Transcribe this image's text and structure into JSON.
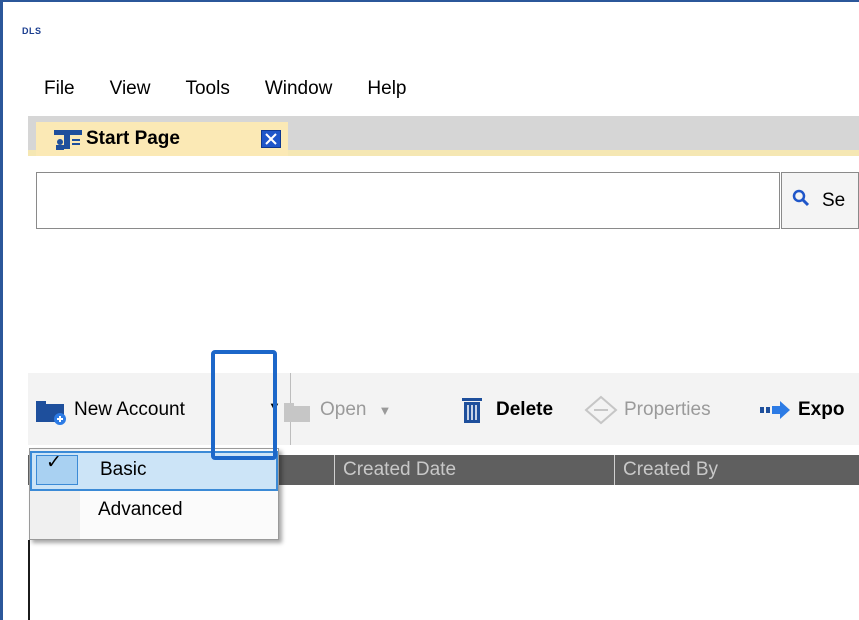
{
  "app": {
    "logo_text": "DLS"
  },
  "menu": {
    "items": [
      "File",
      "View",
      "Tools",
      "Window",
      "Help"
    ]
  },
  "tabs": [
    {
      "label": "Start Page"
    }
  ],
  "search": {
    "value": "",
    "button_label": "Se"
  },
  "toolbar": {
    "new_account": "New Account",
    "open": "Open",
    "delete": "Delete",
    "properties": "Properties",
    "export": "Expo"
  },
  "dropdown": {
    "items": [
      {
        "label": "Basic",
        "checked": true
      },
      {
        "label": "Advanced",
        "checked": false
      }
    ]
  },
  "grid": {
    "columns": [
      "Created Date",
      "Created By"
    ]
  },
  "colors": {
    "frame": "#2b579a",
    "tab_active": "#fbe9b5",
    "highlight": "#1c67c9",
    "grid_header": "#5f5f5f"
  }
}
